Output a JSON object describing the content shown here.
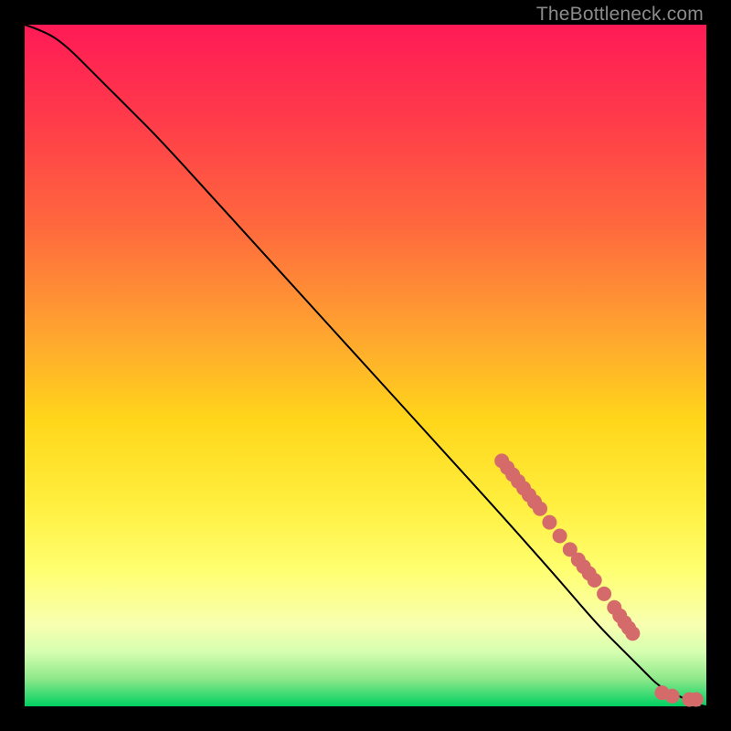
{
  "watermark": "TheBottleneck.com",
  "colors": {
    "dot": "#d56a6a",
    "curve": "#000000"
  },
  "chart_data": {
    "type": "line",
    "title": "",
    "xlabel": "",
    "ylabel": "",
    "xlim": [
      0,
      100
    ],
    "ylim": [
      0,
      100
    ],
    "grid": false,
    "legend": false,
    "series": [
      {
        "name": "curve",
        "kind": "line",
        "x": [
          0,
          3,
          6,
          10,
          15,
          20,
          30,
          40,
          50,
          60,
          70,
          78,
          84,
          88,
          91,
          93,
          95,
          97,
          98,
          99,
          100
        ],
        "y": [
          100,
          99,
          97,
          93,
          88,
          83,
          72,
          61,
          50,
          39,
          28,
          19,
          12,
          8,
          5,
          3,
          2,
          1,
          0.5,
          0.2,
          0
        ]
      },
      {
        "name": "points",
        "kind": "scatter",
        "x": [
          70.0,
          70.8,
          71.6,
          72.4,
          73.2,
          74.0,
          74.8,
          75.6,
          77.0,
          78.5,
          80.0,
          81.2,
          82.0,
          82.8,
          83.6,
          85.0,
          86.5,
          87.3,
          88.0,
          88.6,
          89.2,
          93.5,
          95.0,
          97.5,
          98.5
        ],
        "y": [
          36.0,
          35.0,
          34.0,
          33.0,
          32.0,
          31.0,
          30.0,
          29.0,
          27.0,
          25.0,
          23.0,
          21.5,
          20.5,
          19.5,
          18.5,
          16.5,
          14.5,
          13.3,
          12.3,
          11.5,
          10.7,
          2.0,
          1.5,
          1.0,
          1.0
        ]
      }
    ]
  }
}
